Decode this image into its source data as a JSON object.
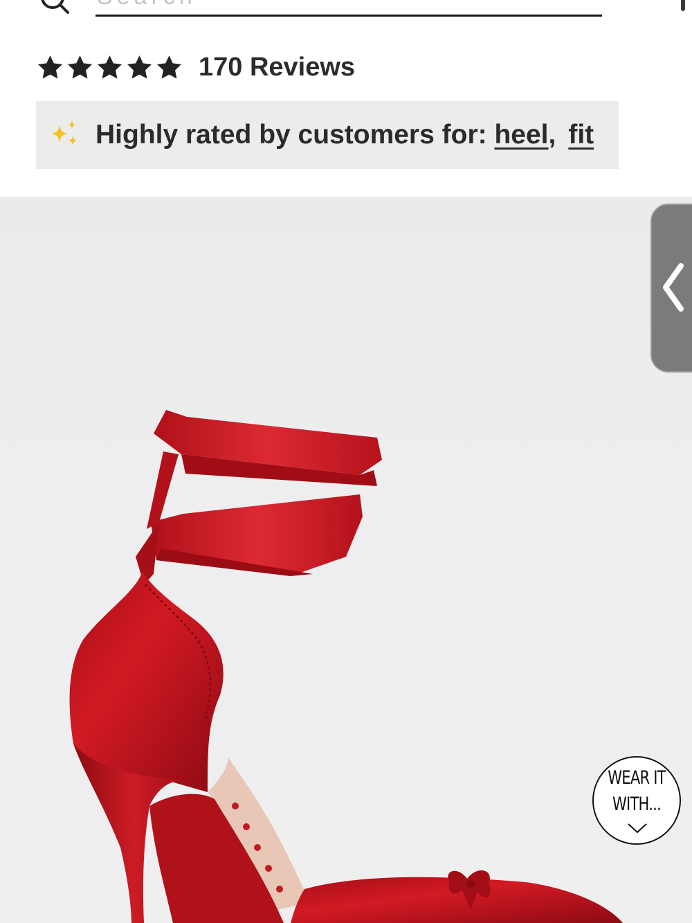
{
  "search": {
    "placeholder": "Search"
  },
  "rating": {
    "stars": 5,
    "max_stars": 5,
    "reviews_label": "170 Reviews"
  },
  "highlights": {
    "prefix": "Highly rated by customers for: ",
    "tags": [
      "heel",
      "fit"
    ],
    "separator": ","
  },
  "badge": {
    "line1": "WEAR IT",
    "line2": "WITH..."
  },
  "colors": {
    "accent_sparkle": "#f4c21b",
    "shoe_red": "#c3121c",
    "star": "#222222"
  },
  "icons": {
    "search": "search-icon",
    "sparkle": "sparkle-icon",
    "star": "star-icon",
    "drawer": "chevron-left-icon",
    "badge_arrow": "chevron-down-icon"
  }
}
